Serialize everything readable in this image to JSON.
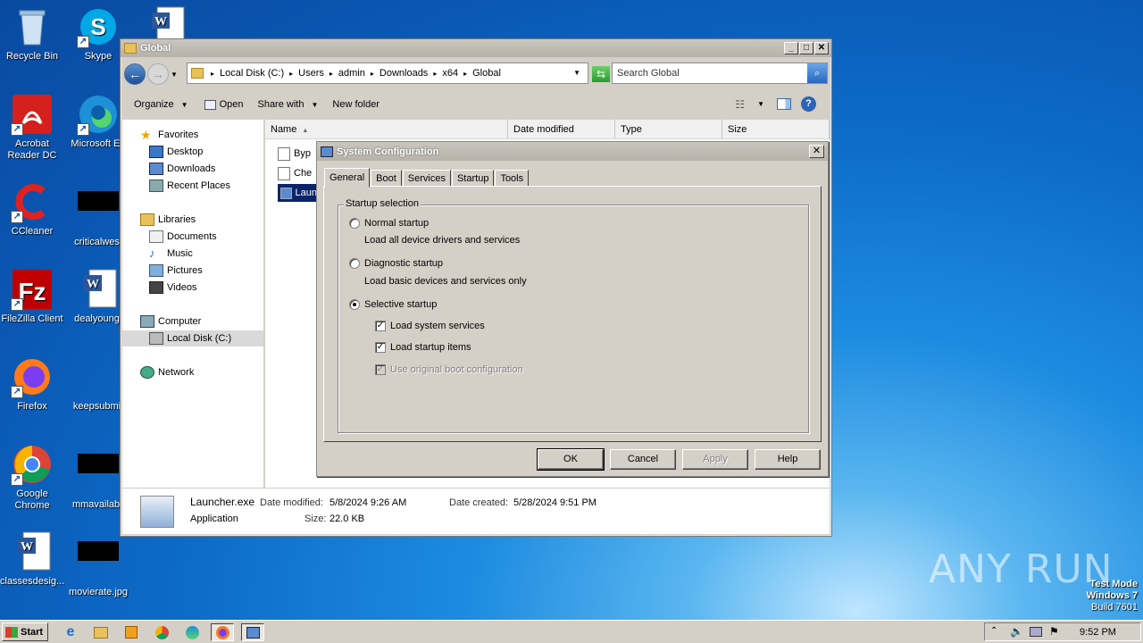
{
  "desktop": {
    "icons": [
      {
        "label": "Recycle Bin"
      },
      {
        "label": "Skype"
      },
      {
        "label": "Acrobat Reader DC"
      },
      {
        "label": "Microsoft Ed"
      },
      {
        "label": "CCleaner"
      },
      {
        "label": "criticalwest"
      },
      {
        "label": "FileZilla Client"
      },
      {
        "label": "dealyoung."
      },
      {
        "label": "Firefox"
      },
      {
        "label": "keepsubmit"
      },
      {
        "label": "Google Chrome"
      },
      {
        "label": "mmavailabil"
      },
      {
        "label": "classesdesig..."
      },
      {
        "label": "movierate.jpg"
      }
    ]
  },
  "explorer": {
    "title": "Global",
    "breadcrumbs": [
      "Local Disk (C:)",
      "Users",
      "admin",
      "Downloads",
      "x64",
      "Global"
    ],
    "search_placeholder": "Search Global",
    "toolbar": {
      "organize": "Organize",
      "open": "Open",
      "share": "Share with",
      "new_folder": "New folder"
    },
    "nav": {
      "favorites": "Favorites",
      "desktop": "Desktop",
      "downloads": "Downloads",
      "recent": "Recent Places",
      "libraries": "Libraries",
      "documents": "Documents",
      "music": "Music",
      "pictures": "Pictures",
      "videos": "Videos",
      "computer": "Computer",
      "local_disk": "Local Disk (C:)",
      "network": "Network"
    },
    "columns": {
      "name": "Name",
      "date": "Date modified",
      "type": "Type",
      "size": "Size"
    },
    "files": [
      {
        "name": "Byp"
      },
      {
        "name": "Che"
      },
      {
        "name": "Laun"
      }
    ],
    "details": {
      "filename": "Launcher.exe",
      "filetype": "Application",
      "modified_label": "Date modified:",
      "modified": "5/8/2024 9:26 AM",
      "created_label": "Date created:",
      "created": "5/28/2024 9:51 PM",
      "size_label": "Size:",
      "size": "22.0 KB"
    }
  },
  "msconfig": {
    "title": "System Configuration",
    "tabs": [
      "General",
      "Boot",
      "Services",
      "Startup",
      "Tools"
    ],
    "group_title": "Startup selection",
    "normal": {
      "label": "Normal startup",
      "desc": "Load all device drivers and services"
    },
    "diagnostic": {
      "label": "Diagnostic startup",
      "desc": "Load basic devices and services only"
    },
    "selective": {
      "label": "Selective startup"
    },
    "checks": {
      "system_services": "Load system services",
      "startup_items": "Load startup items",
      "boot_config": "Use original boot configuration"
    },
    "buttons": {
      "ok": "OK",
      "cancel": "Cancel",
      "apply": "Apply",
      "help": "Help"
    }
  },
  "taskbar": {
    "start": "Start",
    "clock": "9:52 PM"
  },
  "watermark": {
    "brand": "ANY RUN",
    "line1": "Test Mode",
    "line2": "Windows 7",
    "line3": "Build 7601"
  },
  "colors": {
    "accent": "#0a55b0",
    "selection": "#0a246a"
  }
}
